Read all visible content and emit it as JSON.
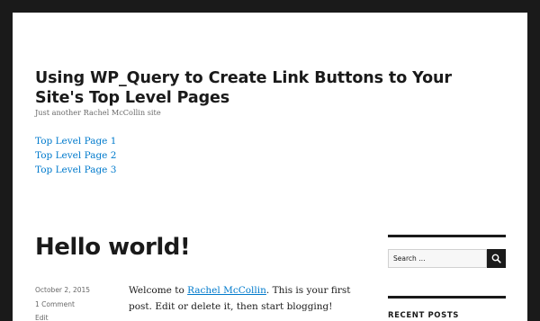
{
  "header": {
    "site_title": "Using WP_Query to Create Link Buttons to Your Site's Top Level Pages",
    "site_description": "Just another Rachel McCollin site"
  },
  "menu": [
    {
      "label": "Top Level Page 1"
    },
    {
      "label": "Top Level Page 2"
    },
    {
      "label": "Top Level Page 3"
    }
  ],
  "post": {
    "title": "Hello world!",
    "date": "October 2, 2015",
    "comments": "1 Comment",
    "edit": "Edit",
    "content_before": "Welcome to ",
    "content_link": "Rachel McCollin",
    "content_after": ". This is your first post. Edit or delete it, then start blogging!"
  },
  "sidebar": {
    "search_placeholder": "Search …",
    "search_icon": "search-icon",
    "recent_posts_title": "RECENT POSTS"
  },
  "colors": {
    "frame": "#1a1a1a",
    "link": "#007acc",
    "meta": "#686868"
  }
}
